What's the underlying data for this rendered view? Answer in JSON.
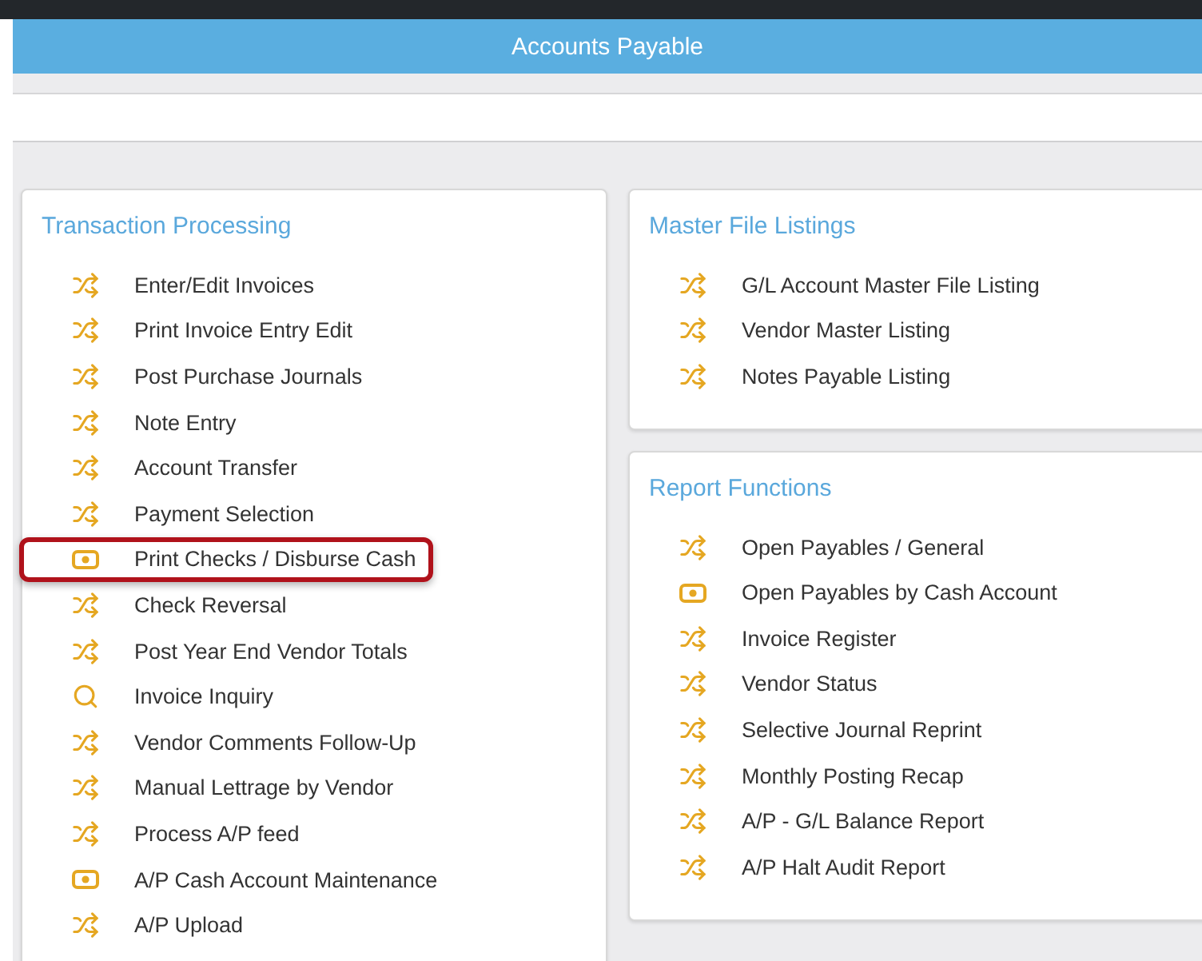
{
  "header": {
    "title": "Accounts Payable"
  },
  "panels": [
    {
      "title": "Transaction Processing",
      "items": [
        {
          "label": "Enter/Edit Invoices",
          "kind": "shuffle",
          "highlighted": false
        },
        {
          "label": "Print Invoice Entry Edit",
          "kind": "shuffle",
          "highlighted": false
        },
        {
          "label": "Post Purchase Journals",
          "kind": "shuffle",
          "highlighted": false
        },
        {
          "label": "Note Entry",
          "kind": "shuffle",
          "highlighted": false
        },
        {
          "label": "Account Transfer",
          "kind": "shuffle",
          "highlighted": false
        },
        {
          "label": "Payment Selection",
          "kind": "shuffle",
          "highlighted": false
        },
        {
          "label": "Print Checks / Disburse Cash",
          "kind": "cash",
          "highlighted": true
        },
        {
          "label": "Check Reversal",
          "kind": "shuffle",
          "highlighted": false
        },
        {
          "label": "Post Year End Vendor Totals",
          "kind": "shuffle",
          "highlighted": false
        },
        {
          "label": "Invoice Inquiry",
          "kind": "search",
          "highlighted": false
        },
        {
          "label": "Vendor Comments Follow-Up",
          "kind": "shuffle",
          "highlighted": false
        },
        {
          "label": "Manual Lettrage by Vendor",
          "kind": "shuffle",
          "highlighted": false
        },
        {
          "label": "Process A/P feed",
          "kind": "shuffle",
          "highlighted": false
        },
        {
          "label": "A/P Cash Account Maintenance",
          "kind": "cash",
          "highlighted": false
        },
        {
          "label": "A/P Upload",
          "kind": "shuffle",
          "highlighted": false
        }
      ]
    },
    {
      "title": "Master File Listings",
      "items": [
        {
          "label": "G/L Account Master File Listing",
          "kind": "shuffle",
          "highlighted": false
        },
        {
          "label": "Vendor Master Listing",
          "kind": "shuffle",
          "highlighted": false
        },
        {
          "label": "Notes Payable Listing",
          "kind": "shuffle",
          "highlighted": false
        }
      ]
    },
    {
      "title": "Report Functions",
      "items": [
        {
          "label": "Open Payables / General",
          "kind": "shuffle",
          "highlighted": false
        },
        {
          "label": "Open Payables by Cash Account",
          "kind": "cash",
          "highlighted": false
        },
        {
          "label": "Invoice Register",
          "kind": "shuffle",
          "highlighted": false
        },
        {
          "label": "Vendor Status",
          "kind": "shuffle",
          "highlighted": false
        },
        {
          "label": "Selective Journal Reprint",
          "kind": "shuffle",
          "highlighted": false
        },
        {
          "label": "Monthly Posting Recap",
          "kind": "shuffle",
          "highlighted": false
        },
        {
          "label": "A/P - G/L Balance Report",
          "kind": "shuffle",
          "highlighted": false
        },
        {
          "label": "A/P Halt Audit Report",
          "kind": "shuffle",
          "highlighted": false
        }
      ]
    }
  ]
}
